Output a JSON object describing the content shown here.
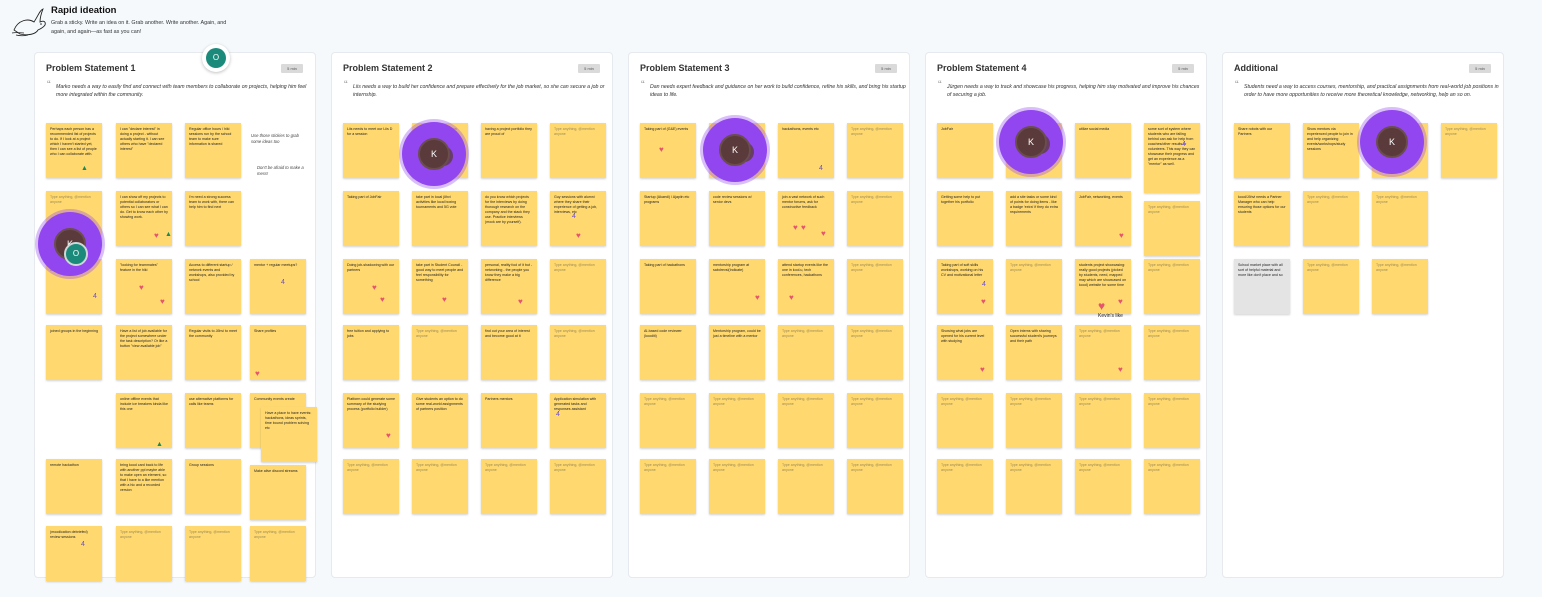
{
  "header": {
    "title": "Rapid ideation",
    "subtitle": "Grab a sticky. Write an idea on it. Grab another. Write another. Again, and again, and again—as fast as you can!"
  },
  "placeholder": "Type anything, @mention anyone",
  "tag_label": "5 min",
  "colors": {
    "sticky": "#ffd970",
    "grey_sticky": "#e4e4e4",
    "avatar_ring": "#9146f0",
    "heart": "#e5566c"
  },
  "columns": [
    {
      "title": "Problem Statement 1",
      "statement": "Marko needs a way to easily find and connect with team members to collaborate on projects, helping him feel more integrated within the community."
    },
    {
      "title": "Problem Statement 2",
      "statement": "Liis needs a way to build her confidence and prepare effectively for the job market, so she can secure a job or internship."
    },
    {
      "title": "Problem Statement 3",
      "statement": "Dan needs expert feedback and guidance on her work to build confidence, refine his skills, and bring his startup ideas to life."
    },
    {
      "title": "Problem Statement 4",
      "statement": "Jürgen needs a way to track and showcase his progress, helping him stay motivated and improve his chances of securing a job."
    },
    {
      "title": "Additional",
      "statement": "Students need a way to access courses, mentorship, and practical assignments from real-world job positions in order to have more opportunities to receive more theoretical knowledge, networking, help an so on."
    }
  ],
  "notes": {
    "c1": [
      "Perhaps each person has a recommended list of projects to do. If I look at a project which I haven't started yet, then I can see a list of people who I can collaborate with.",
      "I can \"declare interest\" in doing a project - without actually starting it. I can see others who have \"declared interest\"",
      "Regular office hours / hiki sessions run by the school team to make sure information is shared",
      "I can show off my projects to potential collaborators or others so I can see what I can do. Get to know each other by showing work.",
      "I'm need a strong success team to work with, there can help him to find next",
      "\"looking for teammates\" feature in the hiki",
      "Access to different startup / network events and workshops, also provided by school",
      "mentor + regular meetups?",
      "joined groups in the beginning",
      "Have a list of job available for the project somewhere under the task description? Or like a button \"view available job\"",
      "Regular visits to Jõhvi to meet the community",
      "Share profiles",
      "online offline events that include ice breakers kinda like this one",
      "use alternative platforms for calls like teams",
      "Community events create",
      "Have a place to have events: hackathons, ideas sprints, time bound problem solving etc",
      "remote hackathon",
      "bring kood card back to life with another ppl maybe able to make open an element, so that I have to a like mention with a hic and a recorded version",
      "Group sessions",
      "Make alive discord streams",
      "(moodication debriefed) review sessions"
    ],
    "c2": [
      "Liis needs to meet our Liis D for a session",
      "having a project portfolio they are proud of",
      "Taking part of JobFair",
      "take part in local jõhvi activities like local boxing tournaments and 5G vote",
      "do you know which projects for the interviews by doing thorough research on the company and the stack they use. Practice interviews (mock are by yourself).",
      "Guy sessions with alumni where they share their experience of getting a job, interviews, etc",
      "Doing job-shadowing with our partners",
      "take part in Student Council - good way to meet people and feel responsibility for something",
      "personal, reality fool of it but - networking - the people you know they make a big difference",
      "free tuition and applying to jobs",
      "find out your area of interest and become good at it",
      "Platform could generate some summary of the studying process (portfolio builder)",
      "Give students an option to do some real-world assignments of partners position",
      "Partners mentors",
      "Application simulation with generated tasks and responses assistant"
    ],
    "c3": [
      "Taking part of (G&E) events",
      "hackathons, events etc",
      "Startup (Akaedi) / Ajapiin etc programs",
      "code review sessions w/ senior devs",
      "join a vast network of such mentor forums, ask for constructive feedback",
      "Taking part of hackathons",
      "mentorship program at sabdrevsl(Indicate)",
      "attend startup events like the one in kool.u, tech conferences, hackathons",
      "AI-based code reviewer (kooditi)",
      "Mentorship program, could be just a timeline with a mentor"
    ],
    "c4": [
      "JobFair",
      "utilize social media",
      "some sort of system where students who are falling behind can ask for help from coaches/other results or volunteers. This way they can showcase their progress and get an experience as a \"mentor\" as well.",
      "Getting some help to put together his portfolio",
      "add a site tasks or some kind of points for doing items - like a badge 'extra' if they do extra requirements",
      "JobFair, networking, events",
      "Taking part of soft skills workshops, working on his CV and motivational letter",
      "students project showcasing: really good projects (picked by students, need, mapped may which are showcased on kood) website for some time",
      "Showing what jobs are opened for his current level with studying",
      "Open interns with sharing successful student's journeys and their path"
    ],
    "c5": [
      "Share robots with our Partners",
      "Show mentors via experienced people to join in and help organizing events/workshops/study sessions",
      "kood/Jõhvi needs a Partner Manager who can help ensuring those options for our students",
      "School market place with all sort of helpful material and more like don't place and so"
    ]
  },
  "avatars": {
    "k": "K",
    "o": "O"
  },
  "annotations": {
    "doodle": "Use those stickies to grab some ideas too",
    "hint": "Don't be afraid to make a mess!",
    "kevin_like": "Kevin's like"
  }
}
